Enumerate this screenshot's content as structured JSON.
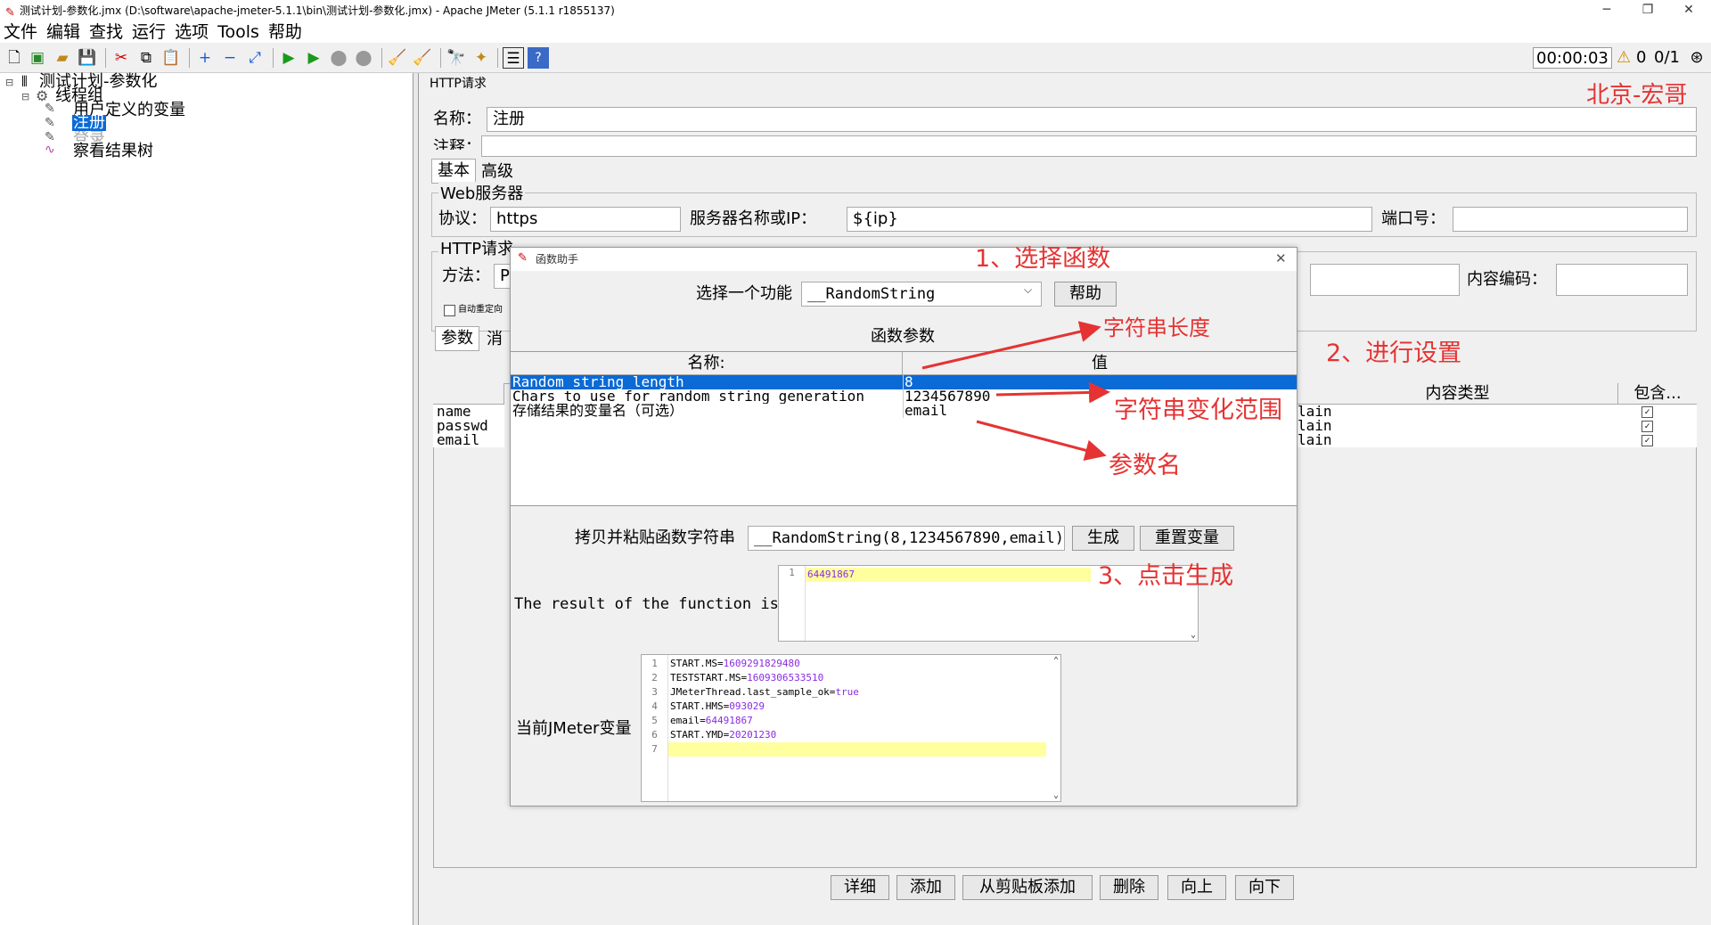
{
  "window": {
    "title": "测试计划-参数化.jmx (D:\\software\\apache-jmeter-5.1.1\\bin\\测试计划-参数化.jmx) - Apache JMeter (5.1.1 r1855137)",
    "minimize": "─",
    "maximize": "❐",
    "close": "✕"
  },
  "menu": [
    "文件",
    "编辑",
    "查找",
    "运行",
    "选项",
    "Tools",
    "帮助"
  ],
  "toolbar": {
    "timer": "00:00:03",
    "warn_count": "0",
    "threads": "0/1"
  },
  "tree": {
    "root": "测试计划-参数化",
    "thread_group": "线程组",
    "user_vars": "用户定义的变量",
    "register": "注册",
    "login": "登录",
    "results": "察看结果树"
  },
  "http": {
    "section_title": "HTTP请求",
    "name_label": "名称：",
    "name_value": "注册",
    "comment_label": "注释：",
    "tab_basic": "基本",
    "tab_advanced": "高级",
    "web_server": "Web服务器",
    "protocol_label": "协议：",
    "protocol_value": "https",
    "server_label": "服务器名称或IP：",
    "server_value": "${ip}",
    "port_label": "端口号：",
    "http_request": "HTTP请求",
    "method_label": "方法：",
    "method_value": "P",
    "encoding_label": "内容编码：",
    "redirect_label": "自动重定向",
    "params_tab": "参数",
    "body_tab": "消",
    "content_type_header": "内容类型",
    "include_header": "包含...",
    "param_names": [
      "name",
      "passwd",
      "email"
    ],
    "content_types": [
      "lain",
      "lain",
      "lain"
    ]
  },
  "bottom_buttons": [
    "详细",
    "添加",
    "从剪贴板添加",
    "删除",
    "向上",
    "向下"
  ],
  "dialog": {
    "title": "函数助手",
    "select_label": "选择一个功能",
    "selected_function": "__RandomString",
    "help_button": "帮助",
    "params_title": "函数参数",
    "col_name": "名称:",
    "col_value": "值",
    "params": [
      {
        "name": "Random string length",
        "value": "8"
      },
      {
        "name": "Chars to use for random string generation",
        "value": "1234567890"
      },
      {
        "name": "存储结果的变量名（可选）",
        "value": "email"
      }
    ],
    "copy_label": "拷贝并粘贴函数字符串",
    "function_string": "__RandomString(8,1234567890,email)}",
    "generate_button": "生成",
    "reset_button": "重置变量",
    "result_label": "The result of the function is",
    "result_value": "64491867",
    "vars_label": "当前JMeter变量",
    "vars": [
      {
        "key": "START.MS=",
        "val": "1609291829480"
      },
      {
        "key": "TESTSTART.MS=",
        "val": "1609306533510"
      },
      {
        "key": "JMeterThread.last_sample_ok=",
        "val": "true"
      },
      {
        "key": "START.HMS=",
        "val": "093029"
      },
      {
        "key": "email=",
        "val": "64491867"
      },
      {
        "key": "START.YMD=",
        "val": "20201230"
      },
      {
        "key": "",
        "val": ""
      }
    ]
  },
  "annotations": {
    "watermark": "北京-宏哥",
    "step1": "1、选择函数",
    "step2": "2、进行设置",
    "step3": "3、点击生成",
    "length": "字符串长度",
    "range": "字符串变化范围",
    "param_name": "参数名"
  },
  "colors": {
    "annotation": "#e53333",
    "selection": "#0a6ad6",
    "highlight_line": "#ffffa0"
  }
}
